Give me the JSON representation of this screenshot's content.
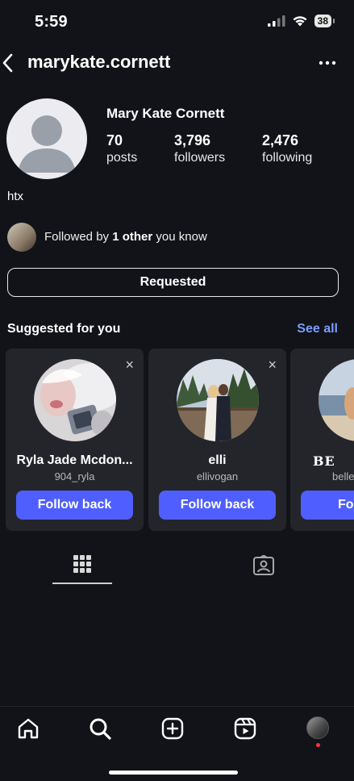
{
  "status": {
    "time": "5:59",
    "battery": "38"
  },
  "header": {
    "username": "marykate.cornett"
  },
  "profile": {
    "full_name": "Mary Kate Cornett",
    "stats": [
      {
        "value": "70",
        "label": "posts"
      },
      {
        "value": "3,796",
        "label": "followers"
      },
      {
        "value": "2,476",
        "label": "following"
      }
    ],
    "bio": "htx",
    "mutual": {
      "prefix": "Followed by ",
      "bold": "1 other",
      "suffix": " you know"
    },
    "requested_label": "Requested"
  },
  "suggested": {
    "title": "Suggested for you",
    "see_all": "See all",
    "cards": [
      {
        "name": "Ryla Jade Mcdon...",
        "handle": "904_ryla",
        "button": "Follow back",
        "close": "×"
      },
      {
        "name": "elli",
        "handle": "ellivogan",
        "button": "Follow back",
        "close": "×"
      },
      {
        "name": "BE",
        "handle": "belle",
        "button": "Fo"
      }
    ]
  },
  "colors": {
    "background": "#111318",
    "accent": "#4f5fff",
    "link": "#7b9cff",
    "card": "#24252b"
  },
  "icons": {
    "header": [
      "back-chevron-icon",
      "more-icon"
    ],
    "tabs": [
      "grid-icon",
      "tagged-icon"
    ],
    "nav": [
      "home-icon",
      "search-icon",
      "create-icon",
      "reels-icon",
      "profile-avatar"
    ]
  }
}
